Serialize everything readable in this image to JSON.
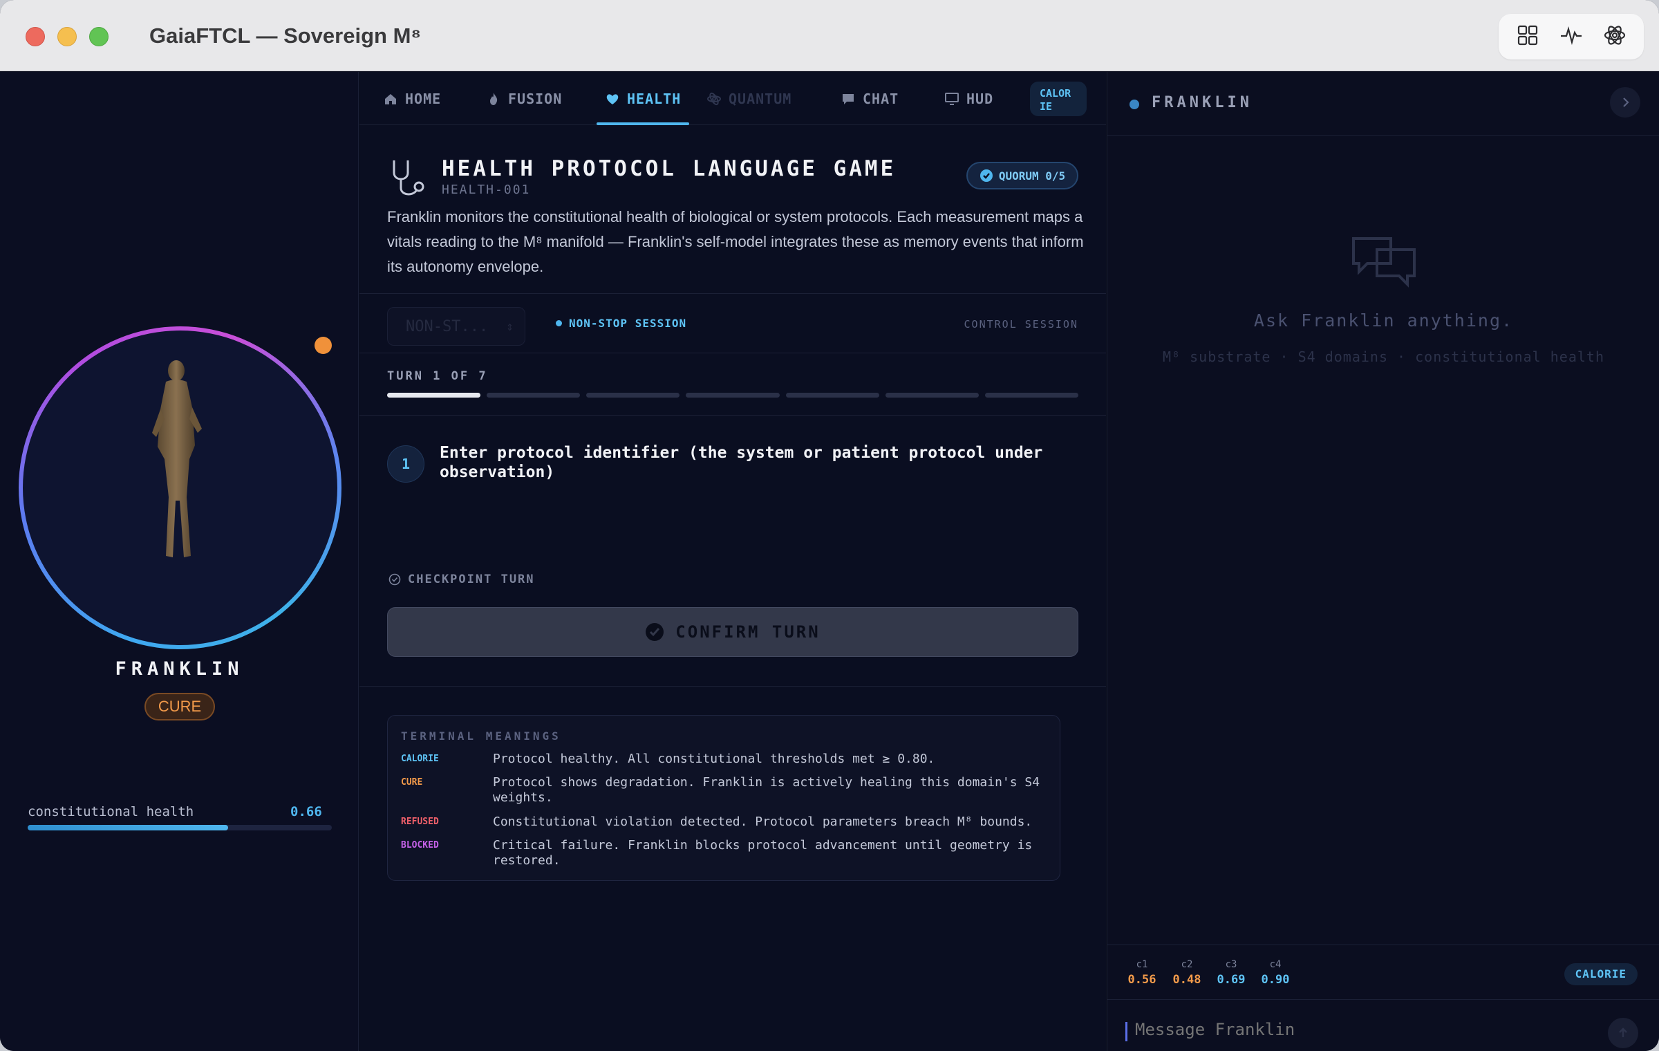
{
  "window": {
    "title": "GaiaFTCL — Sovereign M⁸"
  },
  "toolbar_icons": [
    "grid-icon",
    "pulse-icon",
    "atom-icon"
  ],
  "agent": {
    "name": "FRANKLIN",
    "state": "CURE",
    "health_label": "constitutional health",
    "health_value": "0.66",
    "health_fraction": 0.66
  },
  "tabs": [
    {
      "label": "HOME",
      "icon": "home-icon"
    },
    {
      "label": "FUSION",
      "icon": "flame-icon"
    },
    {
      "label": "HEALTH",
      "icon": "heart-icon",
      "active": true
    },
    {
      "label": "QUANTUM",
      "icon": "atom-icon"
    },
    {
      "label": "CHAT",
      "icon": "chat-icon"
    },
    {
      "label": "HUD",
      "icon": "monitor-icon"
    }
  ],
  "tab_pill": {
    "label": "CALOR\nIE"
  },
  "game": {
    "title": "HEALTH PROTOCOL LANGUAGE GAME",
    "id": "HEALTH-001",
    "quorum": "QUORUM 0/5",
    "description": "Franklin monitors the constitutional health of biological or system protocols. Each measurement maps a vitals reading to the M⁸ manifold — Franklin's self-model integrates these as memory events that inform its autonomy envelope."
  },
  "session": {
    "select_value": "NON-ST...",
    "status": "NON-STOP SESSION",
    "control": "CONTROL SESSION"
  },
  "turn": {
    "label": "TURN 1 OF 7",
    "current": 1,
    "total": 7
  },
  "step": {
    "number": "1",
    "prompt": "Enter protocol identifier (the system or patient protocol under observation)",
    "checkpoint": "CHECKPOINT TURN",
    "confirm": "CONFIRM TURN"
  },
  "terminal": {
    "heading": "TERMINAL MEANINGS",
    "rows": [
      {
        "key": "CALORIE",
        "color": "#5ec3f5",
        "text": "Protocol healthy. All constitutional thresholds met ≥ 0.80."
      },
      {
        "key": "CURE",
        "color": "#f29a4a",
        "text": "Protocol shows degradation. Franklin is actively healing this domain's S4 weights."
      },
      {
        "key": "REFUSED",
        "color": "#f0606a",
        "text": "Constitutional violation detected. Protocol parameters breach M⁸ bounds."
      },
      {
        "key": "BLOCKED",
        "color": "#c561e8",
        "text": "Critical failure. Franklin blocks protocol advancement until geometry is restored."
      }
    ]
  },
  "chat": {
    "title": "FRANKLIN",
    "ask": "Ask Franklin anything.",
    "hint": "M⁸ substrate · S4 domains · constitutional health",
    "metrics": [
      {
        "key": "c1",
        "value": "0.56",
        "color": "#f29a4a"
      },
      {
        "key": "c2",
        "value": "0.48",
        "color": "#f29a4a"
      },
      {
        "key": "c3",
        "value": "0.69",
        "color": "#5ec3f5"
      },
      {
        "key": "c4",
        "value": "0.90",
        "color": "#5ec3f5"
      }
    ],
    "state_badge": "CALORIE",
    "input_placeholder": "Message Franklin"
  }
}
